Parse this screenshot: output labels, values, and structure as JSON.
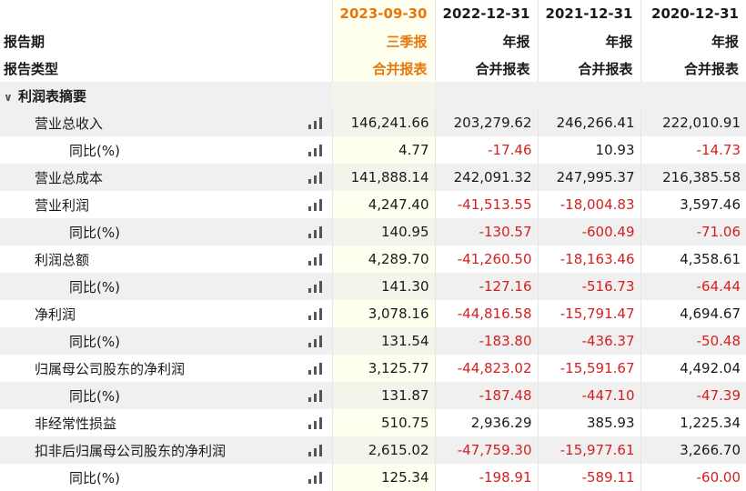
{
  "header": {
    "period_label": "报告期",
    "type_label": "报告类型",
    "columns": [
      {
        "date": "2023-09-30",
        "period": "三季报",
        "type": "合并报表"
      },
      {
        "date": "2022-12-31",
        "period": "年报",
        "type": "合并报表"
      },
      {
        "date": "2021-12-31",
        "period": "年报",
        "type": "合并报表"
      },
      {
        "date": "2020-12-31",
        "period": "年报",
        "type": "合并报表"
      }
    ]
  },
  "section": {
    "title": "利润表摘要",
    "chevron": "chevron-down-icon"
  },
  "colors": {
    "current_period": "#e8770a",
    "negative": "#d42020",
    "row_shade": "#f0f0f0"
  },
  "rows": [
    {
      "label": "营业总收入",
      "level": 1,
      "values": [
        "146,241.66",
        "203,279.62",
        "246,266.41",
        "222,010.91"
      ]
    },
    {
      "label": "同比(%)",
      "level": 2,
      "values": [
        "4.77",
        "-17.46",
        "10.93",
        "-14.73"
      ]
    },
    {
      "label": "营业总成本",
      "level": 1,
      "values": [
        "141,888.14",
        "242,091.32",
        "247,995.37",
        "216,385.58"
      ]
    },
    {
      "label": "营业利润",
      "level": 1,
      "values": [
        "4,247.40",
        "-41,513.55",
        "-18,004.83",
        "3,597.46"
      ]
    },
    {
      "label": "同比(%)",
      "level": 2,
      "values": [
        "140.95",
        "-130.57",
        "-600.49",
        "-71.06"
      ]
    },
    {
      "label": "利润总额",
      "level": 1,
      "values": [
        "4,289.70",
        "-41,260.50",
        "-18,163.46",
        "4,358.61"
      ]
    },
    {
      "label": "同比(%)",
      "level": 2,
      "values": [
        "141.30",
        "-127.16",
        "-516.73",
        "-64.44"
      ]
    },
    {
      "label": "净利润",
      "level": 1,
      "values": [
        "3,078.16",
        "-44,816.58",
        "-15,791.47",
        "4,694.67"
      ]
    },
    {
      "label": "同比(%)",
      "level": 2,
      "values": [
        "131.54",
        "-183.80",
        "-436.37",
        "-50.48"
      ]
    },
    {
      "label": "归属母公司股东的净利润",
      "level": 1,
      "values": [
        "3,125.77",
        "-44,823.02",
        "-15,591.67",
        "4,492.04"
      ]
    },
    {
      "label": "同比(%)",
      "level": 2,
      "values": [
        "131.87",
        "-187.48",
        "-447.10",
        "-47.39"
      ]
    },
    {
      "label": "非经常性损益",
      "level": 1,
      "values": [
        "510.75",
        "2,936.29",
        "385.93",
        "1,225.34"
      ]
    },
    {
      "label": "扣非后归属母公司股东的净利润",
      "level": 1,
      "values": [
        "2,615.02",
        "-47,759.30",
        "-15,977.61",
        "3,266.70"
      ]
    },
    {
      "label": "同比(%)",
      "level": 2,
      "values": [
        "125.34",
        "-198.91",
        "-589.11",
        "-60.00"
      ]
    }
  ]
}
